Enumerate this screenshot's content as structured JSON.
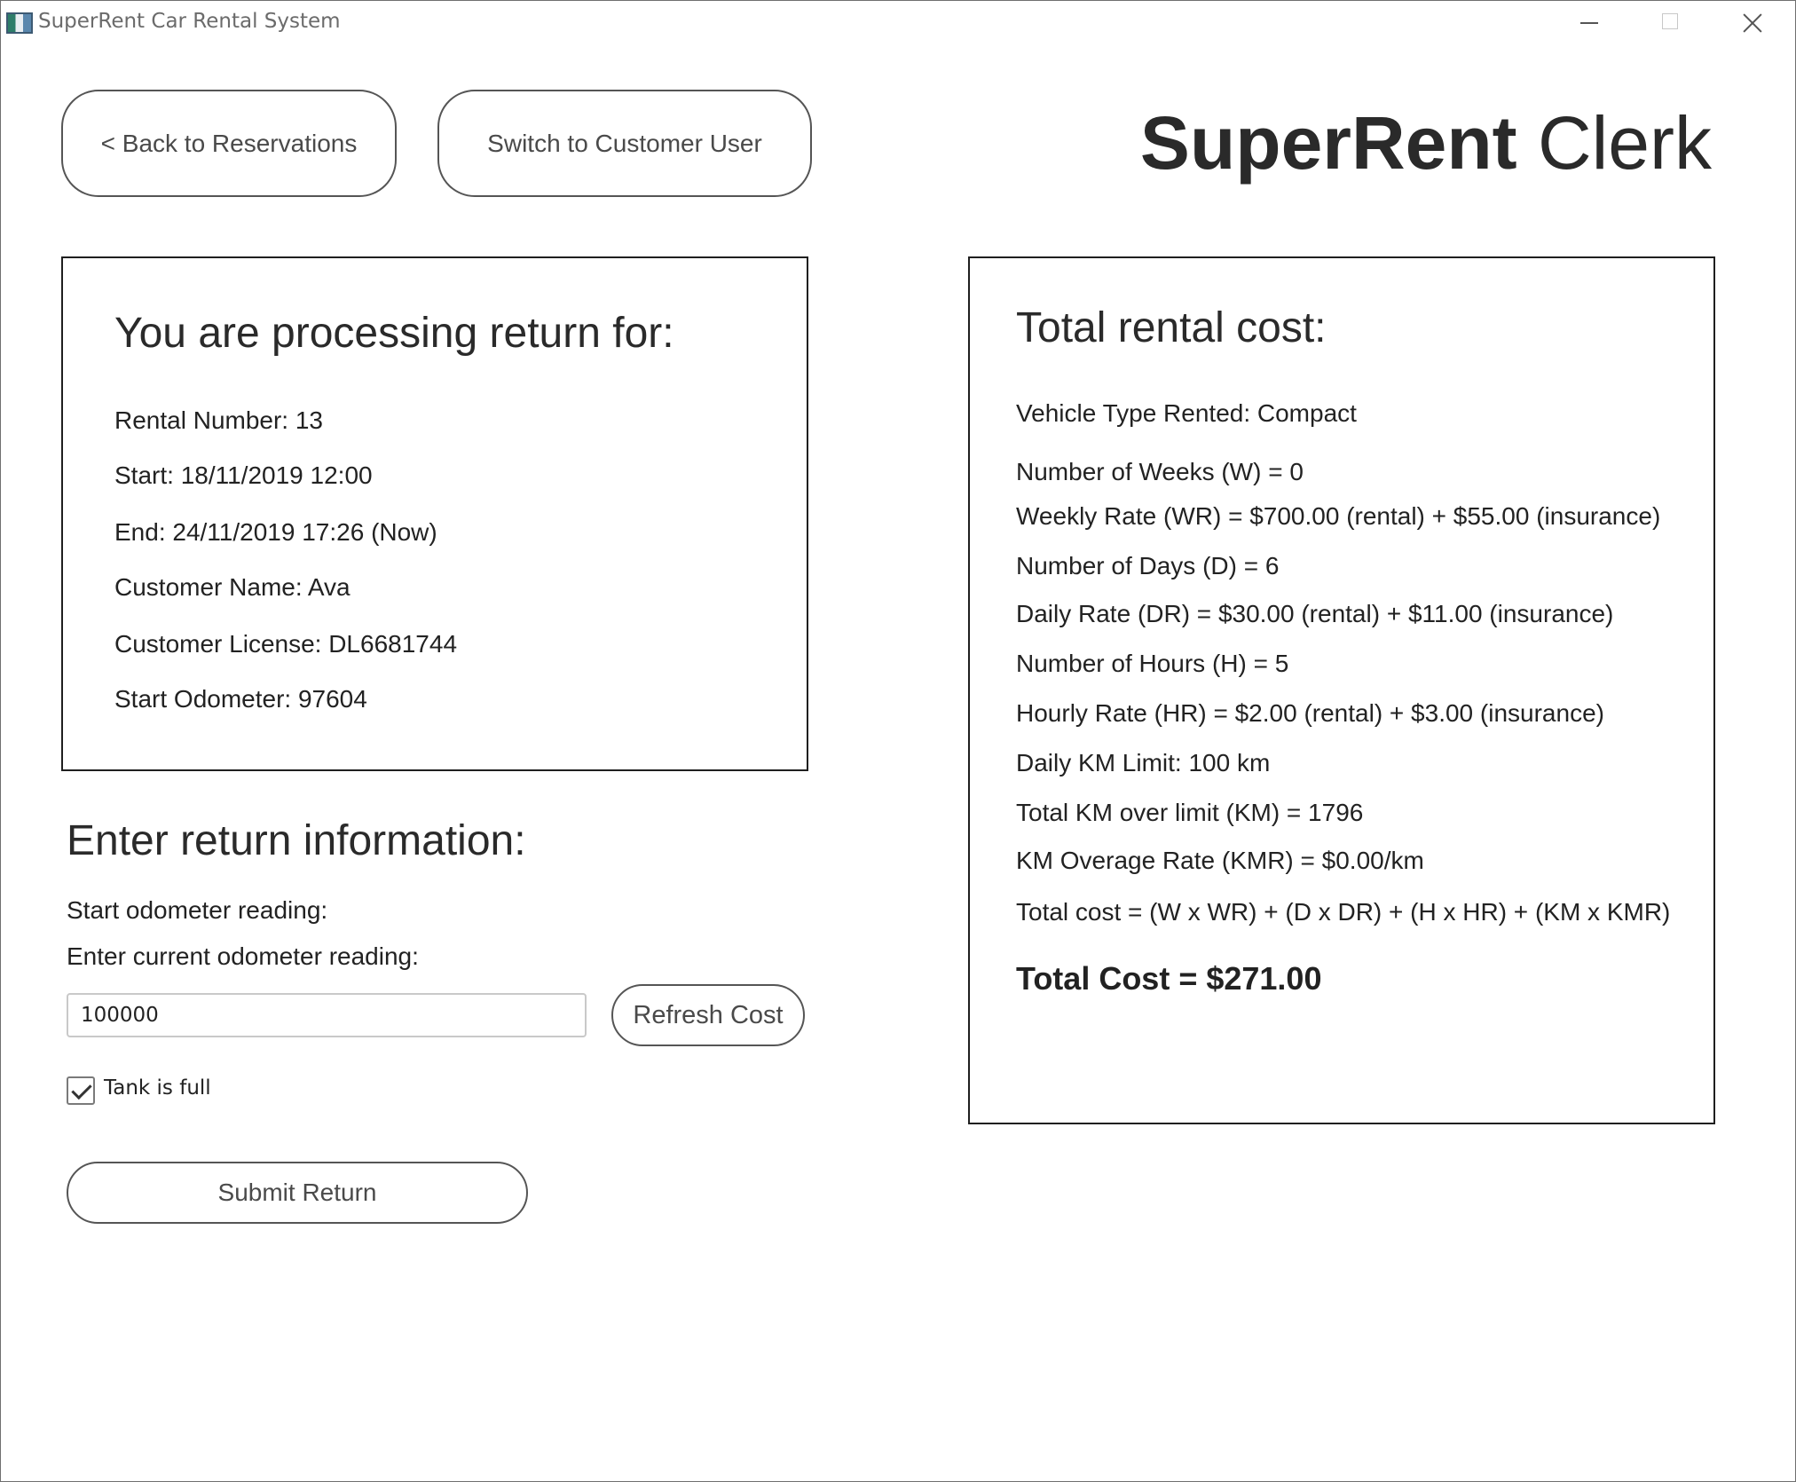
{
  "window": {
    "title": "SuperRent Car Rental System"
  },
  "header": {
    "back_button": "< Back to Reservations",
    "switch_button": "Switch to Customer User",
    "brand_bold": "SuperRent",
    "brand_light": "Clerk"
  },
  "rental_info": {
    "heading": "You are processing return for:",
    "rental_number": "Rental Number: 13",
    "start": "Start: 18/11/2019 12:00",
    "end": "End: 24/11/2019 17:26 (Now)",
    "customer_name": "Customer Name: Ava",
    "customer_license": "Customer License: DL6681744",
    "start_odometer": "Start Odometer: 97604"
  },
  "return_form": {
    "heading": "Enter return information:",
    "start_odometer_label": "Start odometer reading:",
    "current_odometer_label": "Enter current odometer reading:",
    "current_odometer_value": "100000",
    "refresh_button": "Refresh Cost",
    "tank_full_label": "Tank is full",
    "tank_full_checked": true,
    "submit_button": "Submit Return"
  },
  "cost": {
    "heading": "Total rental cost:",
    "vehicle_type": "Vehicle Type Rented: Compact",
    "weeks": "Number of Weeks (W) = 0",
    "weekly_rate": "Weekly Rate (WR) = $700.00 (rental) + $55.00 (insurance)",
    "days": "Number of Days (D) = 6",
    "daily_rate": "Daily Rate (DR) = $30.00 (rental) + $11.00 (insurance)",
    "hours": "Number of Hours (H) = 5",
    "hourly_rate": "Hourly Rate (HR) = $2.00 (rental) + $3.00 (insurance)",
    "daily_km_limit": "Daily KM Limit: 100 km",
    "km_over_limit": "Total KM over limit (KM) = 1796",
    "km_overage_rate": "KM Overage Rate (KMR) = $0.00/km",
    "formula": "Total cost = (W x WR) + (D x DR) + (H x HR) + (KM x KMR)",
    "total": "Total Cost = $271.00"
  }
}
